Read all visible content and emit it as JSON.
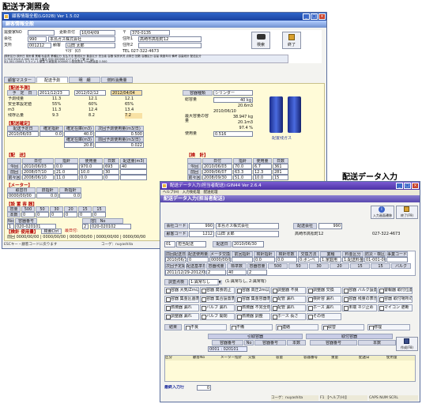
{
  "captions": {
    "left": "配送予測照会",
    "right": "配送データ入力"
  },
  "w1": {
    "title": "顧客情報全般(LG02B) Ver 1.5.02",
    "band": "顧客情報全般",
    "info": {
      "customer_no_label": "需要家NO",
      "customer_no": "",
      "update_date_label": "更新日付",
      "update_date": "10/04/09",
      "zip_label": "〒",
      "zip": "370-0135",
      "company_label": "会社",
      "company_code": "990",
      "company_name": "本島ガス株式会社",
      "address_label": "住所1",
      "address": "高崎市高松町12",
      "branch_label": "支所",
      "branch_code": "001212",
      "name_label": "顧客",
      "name": "山田 太郎",
      "address2_label": "住所2",
      "kana": "ﾔﾏﾀﾞ ﾀﾛｳ",
      "tel": "TEL 027-322-4673"
    },
    "buttons": {
      "search": "検索",
      "exit": "終了"
    },
    "mini_head": [
      "検針区分",
      "検針日",
      "検針順",
      "業種",
      "料金表",
      "業種区分",
      "支払方法",
      "郵送区分",
      "集金区分",
      "担当者",
      "容器",
      "保安状況",
      "点検日",
      "回数",
      "容器区分",
      "容量",
      "検査年月",
      "備考",
      "容量総計",
      "配送区分"
    ],
    "mini_row1": [
      "1",
      "910",
      "0520",
      "A",
      "000",
      "10",
      "20",
      "3:集込",
      "000",
      "000000",
      "2:バンディー管",
      "40 kg"
    ],
    "mini_row2": [
      "01",
      "001",
      "00001",
      "3:ライン",
      "1:緊急",
      "",
      "1:家庭用",
      "000000",
      "1:配送表名",
      "1:kg表返金",
      "0.500"
    ],
    "tabs": [
      "顧客マスター",
      "配送予測",
      "明　細",
      "燃料消費量"
    ],
    "forecast": {
      "title": "【配送予測】",
      "col_heads": [
        "予　定　日",
        "開始日"
      ],
      "r0": [
        "2011/12/23",
        "2012/02/12",
        "2012/04/04"
      ],
      "r1_label": "予測残量",
      "r1": [
        "11.3",
        "12.1",
        "12.1"
      ],
      "r2_label": "安全率設定値",
      "r2": [
        "55%",
        "60%",
        "65%"
      ],
      "r3_label": "m3",
      "r3": [
        "11.3",
        "12.4",
        "13.4"
      ],
      "r4_label": "残存込量",
      "r4": [
        "9.3",
        "8.2",
        "7.2"
      ]
    },
    "vessel": {
      "title": "容器種類",
      "kind": "シリンダー",
      "cap_label": "総容量",
      "cap": "40 kg",
      "m3": "20.6m3",
      "date": "2010/06/10",
      "kg": "38.947 kg",
      "m3b": "20.1m3",
      "pct": "97.4 %",
      "last_label": "最大容量の容量",
      "use_label": "使用量",
      "use": "0.516",
      "tank_label": "配置残ガス"
    },
    "confirm": {
      "title": "【配送確定】",
      "heads": [
        "配送予定日",
        "確定指針",
        "確定在庫(m3)",
        "次回予測使用量(m3/日)"
      ],
      "row": [
        "2010/06/03",
        "0.0",
        "40.0",
        "0.500"
      ],
      "heads2": [
        "確定在庫(m3)",
        "前回予測使用量(m3/日)"
      ],
      "row2": [
        "20.8",
        "0.022"
      ]
    },
    "delivery": {
      "title": "【配　送】",
      "heads": [
        "",
        "日付",
        "指針",
        "使用量",
        "日数",
        "配送量(m3)"
      ],
      "rows": [
        [
          "今回",
          "2010/06/03",
          "0.0",
          "970.0",
          "693",
          "40"
        ],
        [
          "前回",
          "2008/07/10",
          "21.0",
          "10.0",
          "30",
          ""
        ],
        [
          "前々回",
          "2008/06/10",
          "11.0",
          "0.0",
          "0",
          ""
        ]
      ]
    },
    "meter": {
      "title": "【検　針】",
      "heads": [
        "",
        "日付",
        "指針",
        "使用量",
        "日数"
      ],
      "rows": [
        [
          "今回",
          "2010/06/03",
          "70.0",
          "6.7",
          "361"
        ],
        [
          "前回",
          "2009/06/07",
          "63.3",
          "12.3",
          "281"
        ],
        [
          "前々回",
          "2008/09/30",
          "51.0",
          "10.0",
          "15"
        ]
      ]
    },
    "meter2": {
      "title": "【メーター】",
      "heads": [
        "取替日",
        "旧指針",
        "新指針"
      ],
      "row": [
        "0000/00/00",
        "0.0",
        "0.0"
      ]
    },
    "installed": {
      "title": "【設 置 容 器】",
      "heads": [
        "容量",
        "500",
        "50",
        "30",
        "20",
        "15",
        "15"
      ],
      "row_label": "本数",
      "row": [
        "0",
        "0",
        "0",
        "0",
        "0",
        "0"
      ],
      "heads2": [
        "容器番号",
        "No",
        "容器番号"
      ],
      "rows2": [
        [
          "1",
          "020-020101",
          "2",
          "020-020102"
        ]
      ]
    },
    "usage": {
      "title": "【検針 使用量】",
      "btn": "検索Ctrl",
      "dates_label": "最日付:",
      "heads": [
        "前月",
        "今月"
      ],
      "row_label": "前回",
      "row": [
        "0000/00/00",
        "0000/00/00",
        "0000/00/00",
        "0000/00/00",
        "0000/00/00"
      ]
    },
    "status": {
      "left": "ESCキー・顧客コードに戻ります",
      "right": "コーゲ：nuyashita"
    }
  },
  "w2": {
    "title": "配送データ入力(担当者配送):GIN44 Ver 2.6.4",
    "menu": [
      "ヘルプ(H)",
      "入力後処理",
      "配送処理"
    ],
    "band": "配送データ入力(担当者配送)",
    "buttons": {
      "input": "入力画面遷移",
      "exit": "終了(F9)"
    },
    "company_label": "会社コード",
    "company_code": "990",
    "company_name": "本島ガス株式会社",
    "customer_label": "顧客コード",
    "customer_code": "1212",
    "customer_name": "山田 太郎",
    "office_label": "配送会社",
    "office_code": "990",
    "address": "高崎市高松町12",
    "tel": "027-322-4673",
    "route_label": "01",
    "route_name": "担当配送",
    "date_label": "配送日",
    "date": "2010/06/30",
    "grid_heads": [
      "前回配送日",
      "配送使用量",
      "メータ交換",
      "前回指針",
      "検針指針",
      "検針年数",
      "交換方法",
      "業種",
      "料金区分",
      "防災・検区・補助",
      "事業コード"
    ],
    "grid_row": [
      "2010/06/10",
      "0",
      "0000/00/00",
      "",
      "0.0",
      "0.0",
      "0:ボンベ",
      "1:家庭用",
      "1:配送料金表",
      "01-001-0001",
      ""
    ],
    "grid_heads2": [
      "次回予定配送日",
      "配送基準日",
      "容器残量",
      "標準数",
      "容器容量",
      "500",
      "50",
      "30",
      "20",
      "15",
      "15",
      "バルク"
    ],
    "grid_row2": [
      "2011/12/29-2012/02/12-2012/04/04",
      "2",
      "40",
      "2"
    ],
    "check_title": "調査点検",
    "check_value": "1:異常なし",
    "check_note": "(1:異常なし, 2:異常有)",
    "checks": [
      [
        "容器 大気/Zrn以上",
        "容器 腐食防止",
        "容器 高圧2m以上",
        "調整器 不良",
        "調整器 交換",
        "容器 バルク設置",
        "警報器 取付位置"
      ],
      [
        "容器 集金区画表示",
        "容器 集合設置表示",
        "容器 集金容器表示",
        "配管 漏れ",
        "検針容 漏れ",
        "容器 残量の表示",
        "容器 取付場所の不良"
      ],
      [
        "燃焼器 漏れ",
        "バルブ 漏れ",
        "燃焼器 不完全燃焼",
        "配管 漏れ",
        "ホース 漏れ",
        "末端 ネジ止め",
        "マイコン 遮断"
      ],
      [
        "調整器 漏れ",
        "バルブ 開閉",
        "燃焼器 調整",
        "ホース 長さ",
        "その他"
      ]
    ],
    "result_label": "結果",
    "result_opts": [
      "不良",
      "不備",
      "連絡",
      "取替",
      "修理"
    ],
    "pull": {
      "title": "引取容器",
      "heads": [
        "容器番号",
        "No",
        "容器番号",
        "本数"
      ],
      "field": "0001 : 020101"
    },
    "install": {
      "title": "取付容器",
      "heads": [
        "容器番号",
        "本数"
      ]
    },
    "create_btn": "作成(F8)",
    "list_heads": [
      "区分",
      "顧客No",
      "メーター指針",
      "交換",
      "容量",
      "容器番号",
      "重量",
      "配送日",
      "使用量"
    ],
    "latest_label": "最終入力行",
    "latest_value": "0",
    "status": {
      "left": "コーゲ：nuyashita",
      "mid": "F1 【ヘルプ(H)】",
      "right": "CAPS  NUM  SCRL"
    }
  }
}
